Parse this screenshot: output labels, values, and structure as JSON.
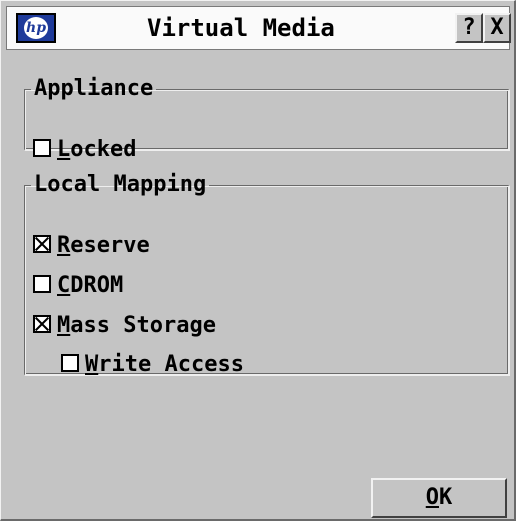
{
  "window": {
    "title": "Virtual Media",
    "logo_text": "hp",
    "help_label": "?",
    "close_label": "X"
  },
  "appliance": {
    "legend": "Appliance",
    "locked": {
      "mnemonic": "L",
      "rest": "ocked",
      "checked": false
    }
  },
  "local_mapping": {
    "legend": "Local Mapping",
    "reserve": {
      "mnemonic": "R",
      "rest": "eserve",
      "checked": true
    },
    "cdrom": {
      "mnemonic": "C",
      "rest": "DROM",
      "checked": false
    },
    "mass_storage": {
      "mnemonic": "M",
      "rest": "ass Storage",
      "checked": true
    },
    "write_access": {
      "mnemonic": "W",
      "rest": "rite Access",
      "checked": false
    }
  },
  "buttons": {
    "ok": {
      "mnemonic": "O",
      "rest": "K"
    }
  },
  "icons": {
    "logo": "hp-logo-icon",
    "help": "help-icon",
    "close": "close-icon",
    "checked_box": "checkbox-checked-icon",
    "unchecked_box": "checkbox-unchecked-icon"
  },
  "colors": {
    "window_bg": "#c4c4c4",
    "titlebar_bg": "#fafafa",
    "logo_bg": "#1e3a9a"
  }
}
